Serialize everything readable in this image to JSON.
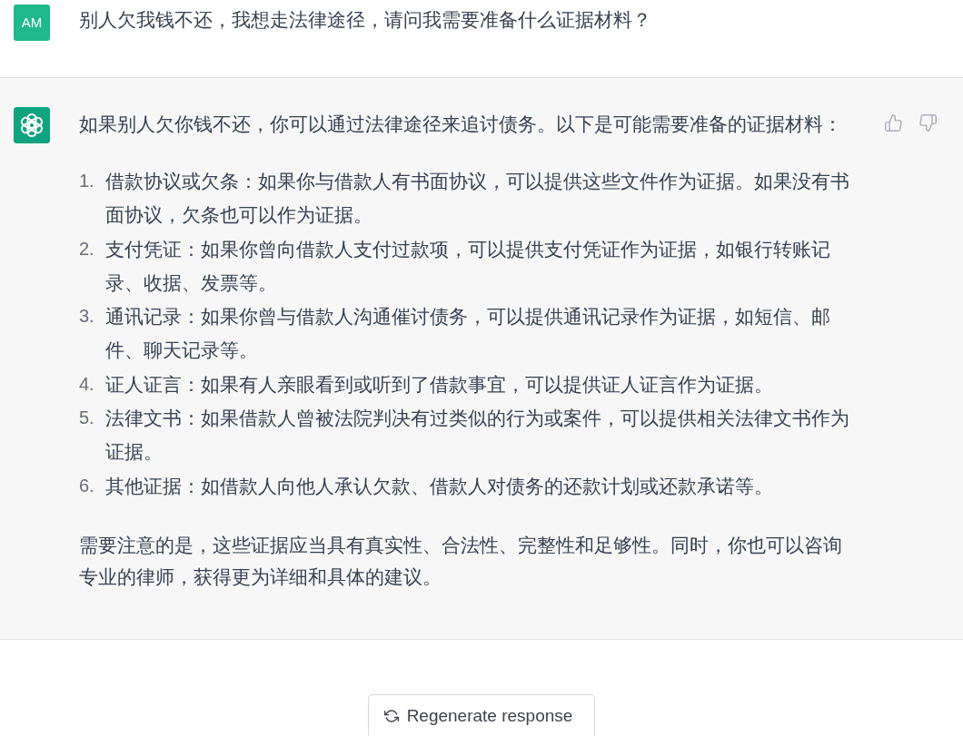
{
  "conversation": [
    {
      "kind": "user",
      "avatar": "AM",
      "text": "别人欠我钱不还，我想走法律途径，请问我需要准备什么证据材料？"
    },
    {
      "kind": "assistant",
      "intro": "如果别人欠你钱不还，你可以通过法律途径来追讨债务。以下是可能需要准备的证据材料：",
      "items": [
        {
          "number": "1.",
          "text": "借款协议或欠条：如果你与借款人有书面协议，可以提供这些文件作为证据。如果没有书面协议，欠条也可以作为证据。"
        },
        {
          "number": "2.",
          "text": "支付凭证：如果你曾向借款人支付过款项，可以提供支付凭证作为证据，如银行转账记录、收据、发票等。"
        },
        {
          "number": "3.",
          "text": "通讯记录：如果你曾与借款人沟通催讨债务，可以提供通讯记录作为证据，如短信、邮件、聊天记录等。"
        },
        {
          "number": "4.",
          "text": "证人证言：如果有人亲眼看到或听到了借款事宜，可以提供证人证言作为证据。"
        },
        {
          "number": "5.",
          "text": "法律文书：如果借款人曾被法院判决有过类似的行为或案件，可以提供相关法律文书作为证据。"
        },
        {
          "number": "6.",
          "text": "其他证据：如借款人向他人承认欠款、借款人对债务的还款计划或还款承诺等。"
        }
      ],
      "closing": "需要注意的是，这些证据应当具有真实性、合法性、完整性和足够性。同时，你也可以咨询专业的律师，获得更为详细和具体的建议。"
    }
  ],
  "regenerate_button": {
    "label": "Regenerate response"
  }
}
